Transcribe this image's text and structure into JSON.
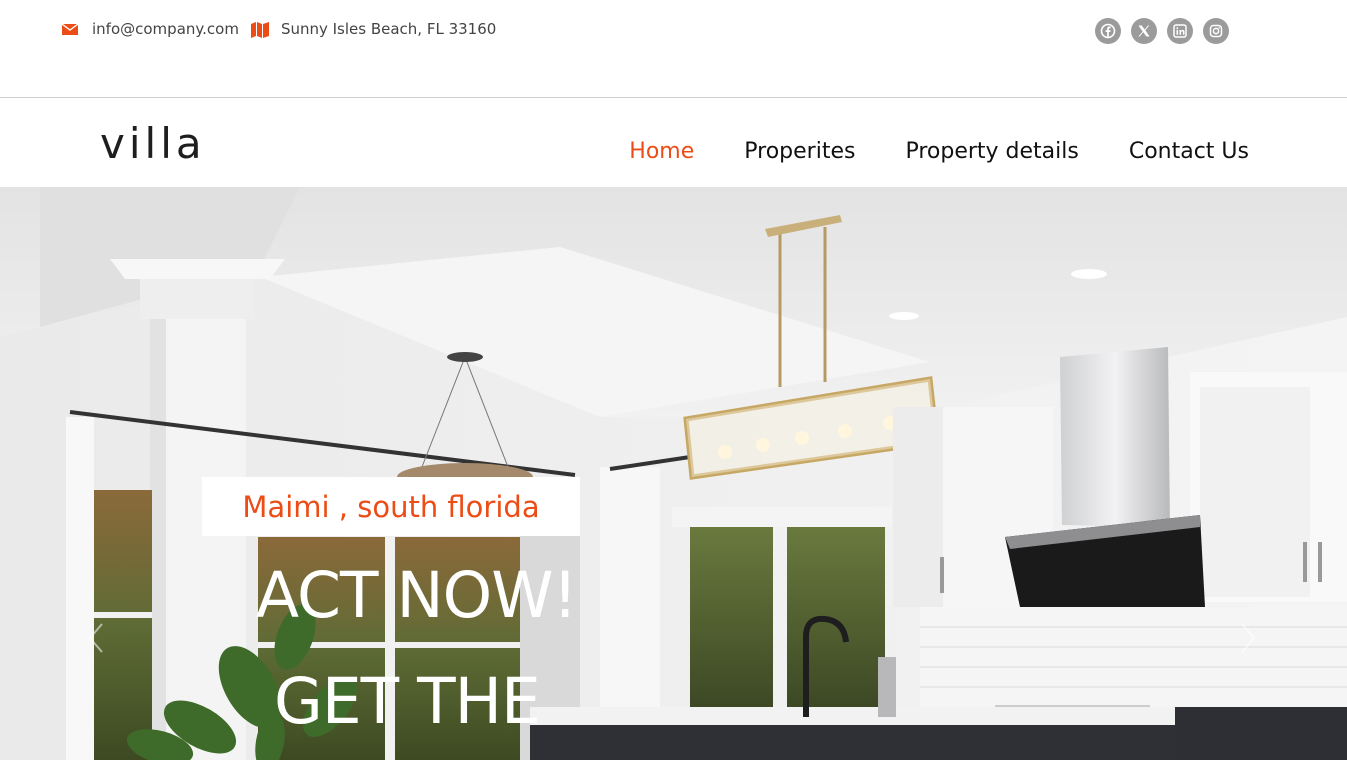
{
  "topbar": {
    "email": "info@company.com",
    "address": "Sunny Isles Beach, FL 33160",
    "email_icon": "envelope-icon",
    "address_icon": "map-icon",
    "social": [
      "facebook-icon",
      "x-twitter-icon",
      "linkedin-icon",
      "instagram-icon"
    ]
  },
  "navbar": {
    "logo": "villa",
    "items": [
      {
        "label": "Home",
        "active": true
      },
      {
        "label": "Properites",
        "active": false
      },
      {
        "label": "Property details",
        "active": false
      },
      {
        "label": "Contact Us",
        "active": false
      }
    ]
  },
  "hero": {
    "badge": "Maimi , south florida",
    "headline_1": "ACT NOW!",
    "headline_2": "GET THE",
    "prev_icon": "chevron-left-icon",
    "next_icon": "chevron-right-icon"
  },
  "colors": {
    "accent": "#ec4c16",
    "social_bg": "#9b9b9b",
    "text_dark": "#111111"
  }
}
